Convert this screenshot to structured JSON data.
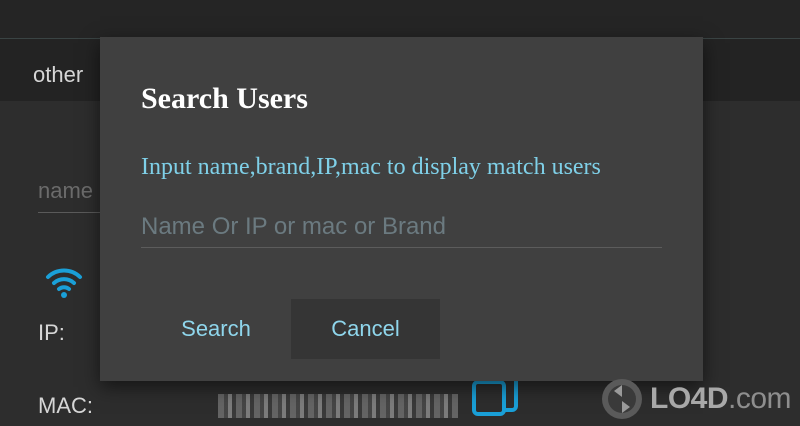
{
  "background": {
    "tab_label": "other",
    "name_field_placeholder": "name",
    "ip_label": "IP:",
    "mac_label": "MAC:",
    "icons": {
      "wifi": "wifi-icon",
      "copy": "copy-icon"
    }
  },
  "dialog": {
    "title": "Search Users",
    "hint": "Input name,brand,IP,mac to display match users",
    "search_field": {
      "value": "",
      "placeholder": "Name Or IP or mac or Brand"
    },
    "buttons": {
      "search_label": "Search",
      "cancel_label": "Cancel"
    }
  },
  "watermark": {
    "brand_strong": "LO4D",
    "brand_suffix": ".com"
  },
  "colors": {
    "accent": "#8fd6ec",
    "hint_text": "#7fd0e8",
    "dialog_bg": "#404040",
    "wifi_icon": "#1aa0d8"
  }
}
